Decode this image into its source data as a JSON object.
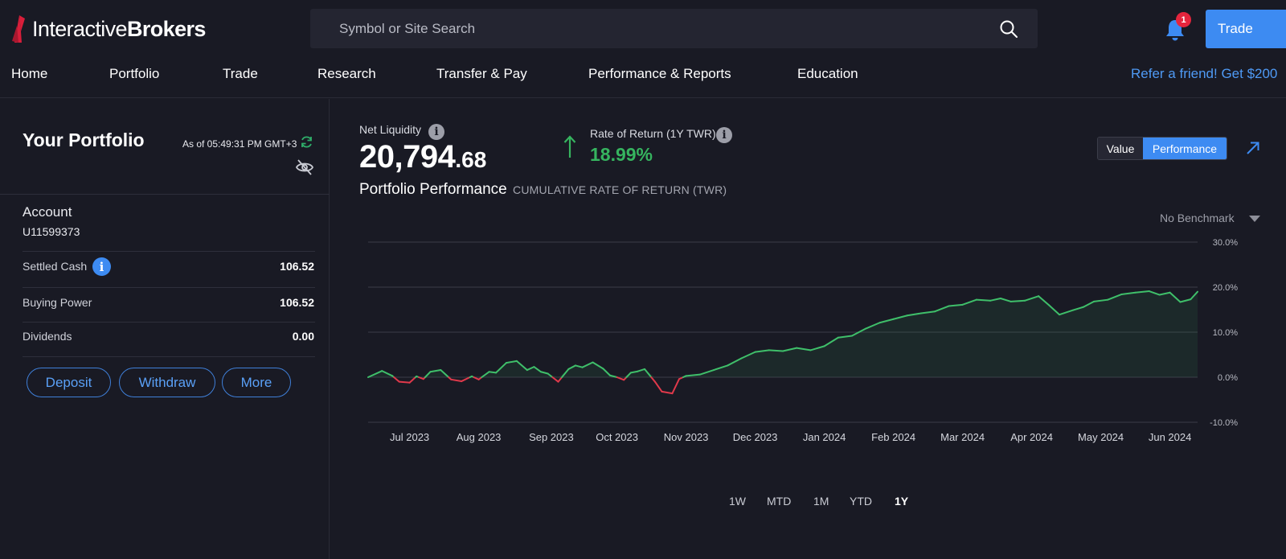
{
  "header": {
    "logo_text_regular": "Interactive",
    "logo_text_bold": "Brokers",
    "search_placeholder": "Symbol or Site Search",
    "notification_count": "1",
    "trade_button": "Trade"
  },
  "nav": {
    "items": [
      "Home",
      "Portfolio",
      "Trade",
      "Research",
      "Transfer & Pay",
      "Performance & Reports",
      "Education"
    ],
    "refer": "Refer a friend! Get $200"
  },
  "portfolio": {
    "title": "Your Portfolio",
    "as_of": "As of 05:49:31 PM GMT+3",
    "account_label": "Account",
    "account_id": "U11599373",
    "rows": [
      {
        "label": "Settled Cash",
        "value": "106.52"
      },
      {
        "label": "Buying Power",
        "value": "106.52"
      },
      {
        "label": "Dividends",
        "value": "0.00"
      }
    ],
    "buttons": [
      "Deposit",
      "Withdraw",
      "More"
    ]
  },
  "summary": {
    "net_liquidity_label": "Net Liquidity",
    "net_liquidity_int": "20,794",
    "net_liquidity_dec": ".68",
    "ror_label": "Rate of Return (1Y TWR)",
    "ror_value": "18.99%",
    "perf_title": "Portfolio Performance",
    "perf_subtitle": "CUMULATIVE RATE OF RETURN (TWR)",
    "toggle": [
      "Value",
      "Performance"
    ],
    "toggle_active": "Performance",
    "benchmark": "No Benchmark"
  },
  "colors": {
    "positive": "#3fbf6a",
    "negative": "#e0394b",
    "accent": "#3d8bf2",
    "background": "#191a24"
  },
  "chart_data": {
    "type": "line",
    "title": "Portfolio Performance",
    "ylabel": "",
    "xlabel": "",
    "ylim": [
      -10,
      30
    ],
    "y_ticks": [
      "30.0%",
      "20.0%",
      "10.0%",
      "0.0%",
      "-10.0%"
    ],
    "y_tick_values": [
      30,
      20,
      10,
      0,
      -10
    ],
    "x_ticks": [
      "Jul 2023",
      "Aug 2023",
      "Sep 2023",
      "Oct 2023",
      "Nov 2023",
      "Dec 2023",
      "Jan 2024",
      "Feb 2024",
      "Mar 2024",
      "Apr 2024",
      "May 2024",
      "Jun 2024"
    ],
    "x_tick_positions": [
      0.6,
      1.6,
      2.65,
      3.6,
      4.6,
      5.6,
      6.6,
      7.6,
      8.6,
      9.6,
      10.6,
      11.6
    ],
    "x_domain": [
      0,
      12
    ],
    "grid": true,
    "series": [
      {
        "x": [
          0.0,
          0.2,
          0.35,
          0.45,
          0.6,
          0.7,
          0.8,
          0.9,
          1.05,
          1.2,
          1.35,
          1.5,
          1.6,
          1.75,
          1.85,
          2.0,
          2.15,
          2.3,
          2.4,
          2.5,
          2.6,
          2.75,
          2.9,
          3.0,
          3.1,
          3.25,
          3.4,
          3.5,
          3.6,
          3.7,
          3.8,
          3.9,
          4.0,
          4.15,
          4.25,
          4.4,
          4.5,
          4.6,
          4.8,
          5.0,
          5.2,
          5.4,
          5.6,
          5.8,
          6.0,
          6.2,
          6.4,
          6.6,
          6.8,
          7.0,
          7.2,
          7.4,
          7.6,
          7.8,
          8.0,
          8.2,
          8.4,
          8.6,
          8.8,
          9.0,
          9.15,
          9.3,
          9.5,
          9.7,
          9.85,
          10.0,
          10.2,
          10.35,
          10.5,
          10.7,
          10.9,
          11.1,
          11.3,
          11.45,
          11.6,
          11.75,
          11.9,
          12.0
        ],
        "values": [
          0.0,
          1.4,
          0.3,
          -1.0,
          -1.2,
          0.2,
          -0.4,
          1.2,
          1.6,
          -0.5,
          -0.9,
          0.2,
          -0.5,
          1.2,
          1.0,
          3.2,
          3.6,
          1.6,
          2.3,
          1.2,
          0.8,
          -1.0,
          1.8,
          2.6,
          2.2,
          3.3,
          1.9,
          0.4,
          0.0,
          -0.6,
          1.0,
          1.3,
          1.8,
          -1.0,
          -3.2,
          -3.6,
          -0.4,
          0.3,
          0.6,
          1.6,
          2.6,
          4.2,
          5.6,
          6.0,
          5.8,
          6.5,
          6.0,
          6.9,
          8.8,
          9.2,
          10.8,
          12.1,
          12.9,
          13.7,
          14.2,
          14.6,
          15.8,
          16.1,
          17.2,
          17.0,
          17.5,
          16.8,
          17.0,
          18.0,
          16.0,
          13.9,
          14.9,
          15.6,
          16.8,
          17.2,
          18.4,
          18.8,
          19.1,
          18.3,
          18.8,
          16.7,
          17.3,
          18.99
        ]
      }
    ]
  },
  "ranges": {
    "items": [
      "1W",
      "MTD",
      "1M",
      "YTD",
      "1Y"
    ],
    "active": "1Y"
  }
}
